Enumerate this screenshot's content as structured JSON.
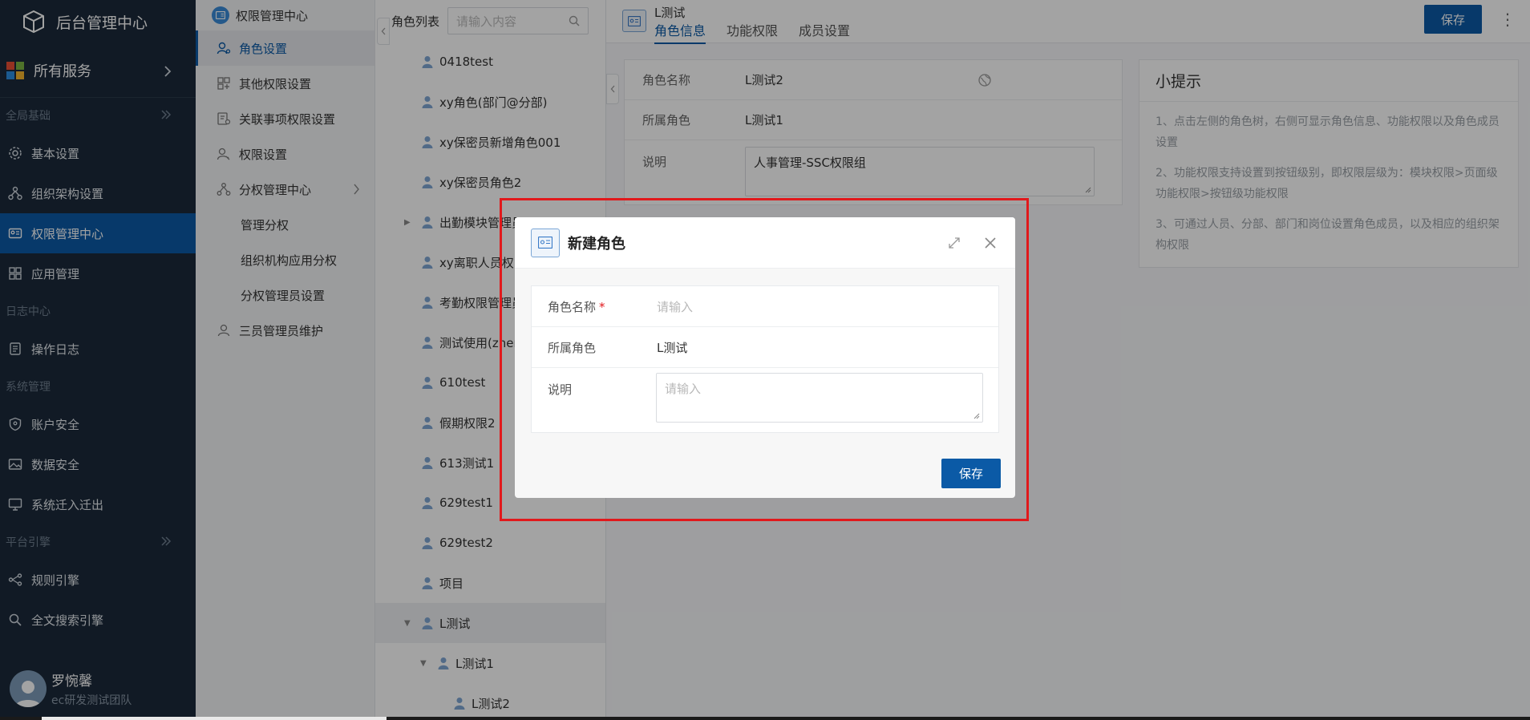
{
  "sidebar": {
    "title": "后台管理中心",
    "all_services": "所有服务",
    "groups": [
      {
        "label": "全局基础"
      },
      {
        "label": "日志中心"
      },
      {
        "label": "系统管理"
      },
      {
        "label": "平台引擎"
      }
    ],
    "items": [
      {
        "label": "基本设置",
        "icon": "gear-icon"
      },
      {
        "label": "组织架构设置",
        "icon": "org-chart-icon"
      },
      {
        "label": "权限管理中心",
        "icon": "id-card-icon"
      },
      {
        "label": "应用管理",
        "icon": "grid-icon"
      },
      {
        "label": "操作日志",
        "icon": "log-icon"
      },
      {
        "label": "账户安全",
        "icon": "shield-icon"
      },
      {
        "label": "数据安全",
        "icon": "image-icon"
      },
      {
        "label": "系统迁入迁出",
        "icon": "monitor-icon"
      },
      {
        "label": "规则引擎",
        "icon": "flow-icon"
      },
      {
        "label": "全文搜索引擎",
        "icon": "search-icon"
      }
    ],
    "user": {
      "name": "罗惋馨",
      "team": "ec研发测试团队"
    }
  },
  "menu2": {
    "header": "权限管理中心",
    "items": [
      {
        "label": "角色设置"
      },
      {
        "label": "其他权限设置"
      },
      {
        "label": "关联事项权限设置"
      },
      {
        "label": "权限设置"
      },
      {
        "label": "分权管理中心"
      },
      {
        "label": "管理分权"
      },
      {
        "label": "组织机构应用分权"
      },
      {
        "label": "分权管理员设置"
      },
      {
        "label": "三员管理员维护"
      }
    ]
  },
  "tree": {
    "label": "角色列表",
    "search_placeholder": "请输入内容",
    "nodes": [
      {
        "label": "0418test"
      },
      {
        "label": "xy角色(部门@分部)"
      },
      {
        "label": "xy保密员新增角色001"
      },
      {
        "label": "xy保密员角色2"
      },
      {
        "label": "出勤模块管理员"
      },
      {
        "label": "xy离职人员权限"
      },
      {
        "label": "考勤权限管理员"
      },
      {
        "label": "测试使用(zhen"
      },
      {
        "label": "610test"
      },
      {
        "label": "假期权限2"
      },
      {
        "label": "613测试1"
      },
      {
        "label": "629test1"
      },
      {
        "label": "629test2"
      },
      {
        "label": "项目"
      },
      {
        "label": "L测试"
      },
      {
        "label": "L测试1"
      },
      {
        "label": "L测试2"
      }
    ]
  },
  "content": {
    "title": "L测试",
    "tabs": [
      {
        "label": "角色信息"
      },
      {
        "label": "功能权限"
      },
      {
        "label": "成员设置"
      }
    ],
    "save_label": "保存",
    "form": {
      "name_label": "角色名称",
      "name_value": "L测试2",
      "parent_label": "所属角色",
      "parent_value": "L测试1",
      "desc_label": "说明",
      "desc_value": "人事管理-SSC权限组"
    },
    "tips": {
      "title": "小提示",
      "lines": [
        "1、点击左侧的角色树，右侧可显示角色信息、功能权限以及角色成员设置",
        "2、功能权限支持设置到按钮级别，即权限层级为：模块权限>页面级功能权限>按钮级功能权限",
        "3、可通过人员、分部、部门和岗位设置角色成员，以及相应的组织架构权限"
      ]
    }
  },
  "modal": {
    "title": "新建角色",
    "name_label": "角色名称",
    "required_mark": "*",
    "name_placeholder": "请输入",
    "parent_label": "所属角色",
    "parent_value": "L测试",
    "desc_label": "说明",
    "desc_placeholder": "请输入",
    "save_label": "保存"
  },
  "colors": {
    "primary": "#0b5aa6",
    "sidebar_bg": "#1c2a3a",
    "highlight_border": "#e1191c"
  }
}
